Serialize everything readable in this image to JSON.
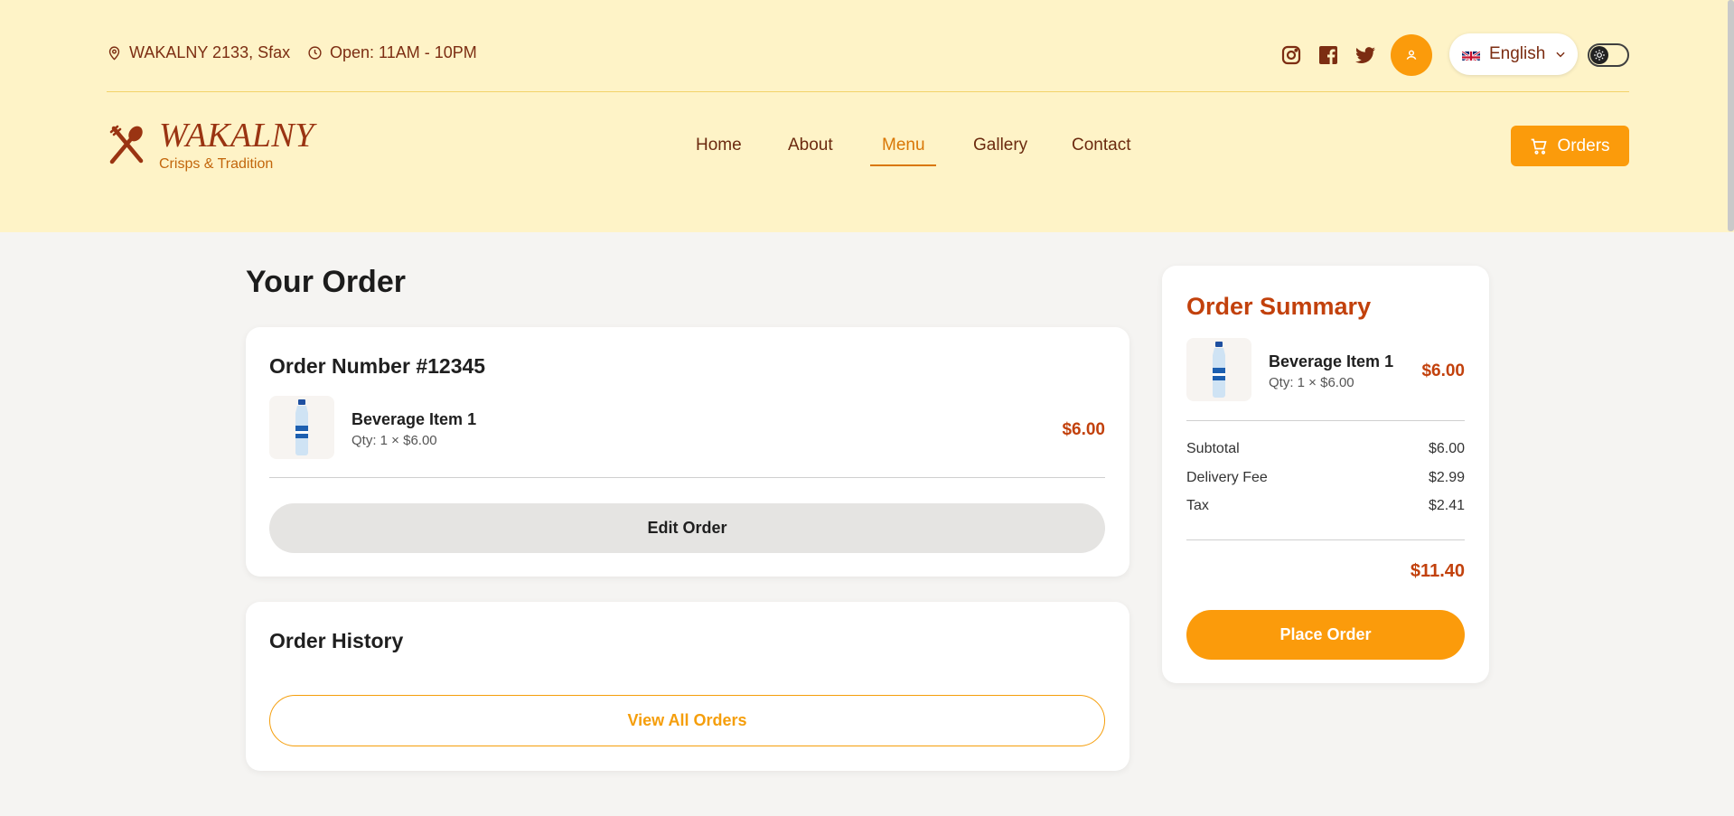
{
  "topbar": {
    "address": "WAKALNY 2133, Sfax",
    "hours": "Open: 11AM - 10PM",
    "social": [
      "instagram-icon",
      "facebook-icon",
      "twitter-icon"
    ],
    "language": "English"
  },
  "brand": {
    "name": "WAKALNY",
    "tagline": "Crisps & Tradition"
  },
  "nav": {
    "items": [
      "Home",
      "About",
      "Menu",
      "Gallery",
      "Contact"
    ],
    "active": "Menu",
    "orders_label": "Orders"
  },
  "order": {
    "page_title": "Your Order",
    "number_label": "Order Number #12345",
    "item": {
      "name": "Beverage Item 1",
      "qty": "Qty: 1 × $6.00",
      "price": "$6.00"
    },
    "edit_label": "Edit Order"
  },
  "history": {
    "title": "Order History",
    "view_label": "View All Orders"
  },
  "summary": {
    "title": "Order Summary",
    "item": {
      "name": "Beverage Item 1",
      "qty": "Qty: 1 × $6.00",
      "price": "$6.00"
    },
    "rows": [
      {
        "label": "Subtotal",
        "value": "$6.00"
      },
      {
        "label": "Delivery Fee",
        "value": "$2.99"
      },
      {
        "label": "Tax",
        "value": "$2.41"
      }
    ],
    "total": "$11.40",
    "place_label": "Place Order"
  },
  "colors": {
    "header_bg": "#fef3c7",
    "accent": "#fb9b0b",
    "brand_brown": "#9a3412",
    "price": "#c2410c"
  }
}
